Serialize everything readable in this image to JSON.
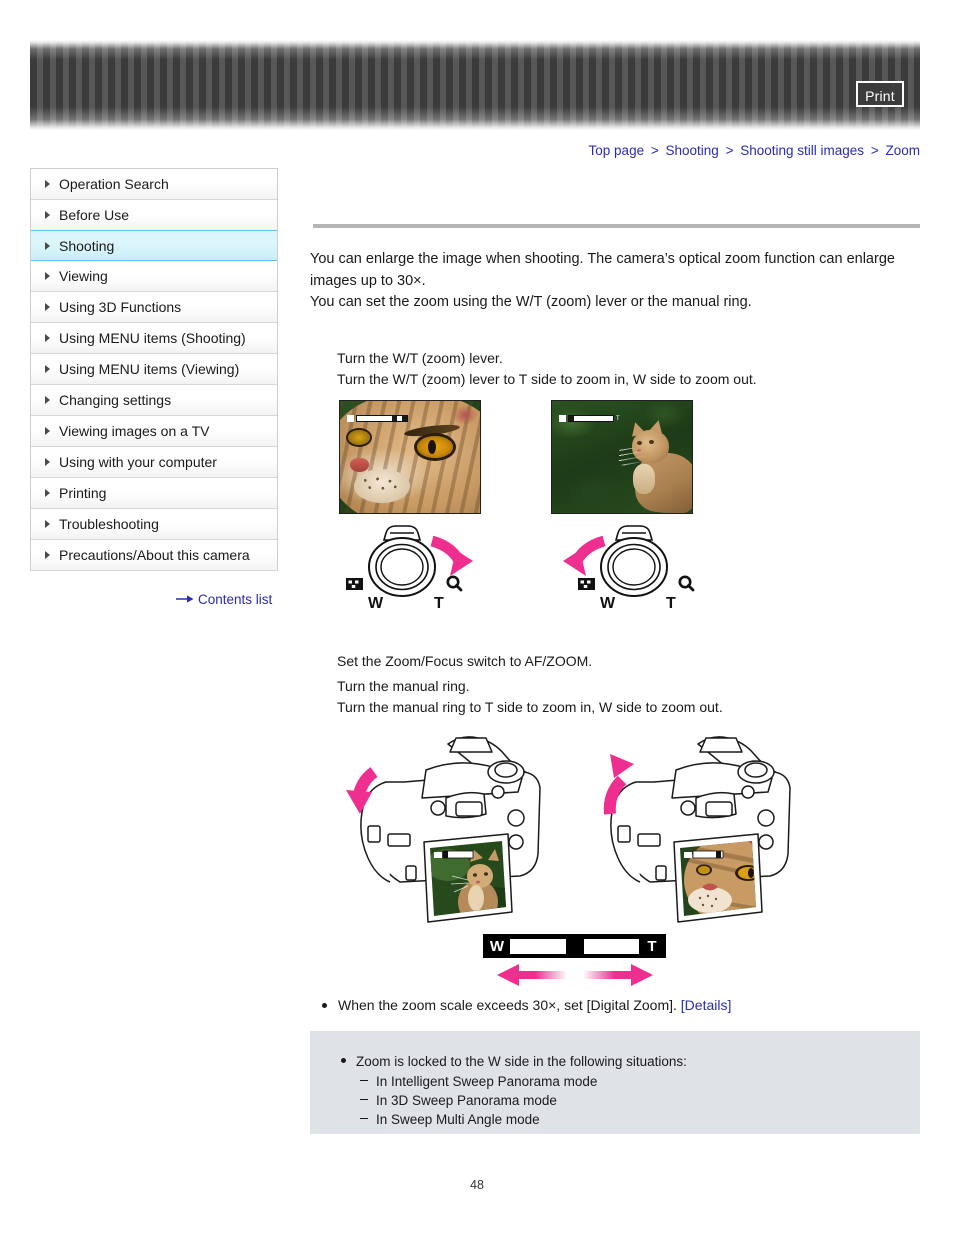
{
  "header": {
    "print_label": "Print"
  },
  "breadcrumb": {
    "items": [
      "Top page",
      "Shooting",
      "Shooting still images",
      "Zoom"
    ],
    "separator": ">"
  },
  "sidebar": {
    "items": [
      {
        "label": "Operation Search",
        "active": false
      },
      {
        "label": "Before Use",
        "active": false
      },
      {
        "label": "Shooting",
        "active": true
      },
      {
        "label": "Viewing",
        "active": false
      },
      {
        "label": "Using 3D Functions",
        "active": false
      },
      {
        "label": "Using MENU items (Shooting)",
        "active": false
      },
      {
        "label": "Using MENU items (Viewing)",
        "active": false
      },
      {
        "label": "Changing settings",
        "active": false
      },
      {
        "label": "Viewing images on a TV",
        "active": false
      },
      {
        "label": "Using with your computer",
        "active": false
      },
      {
        "label": "Printing",
        "active": false
      },
      {
        "label": "Troubleshooting",
        "active": false
      },
      {
        "label": "Precautions/About this camera",
        "active": false
      }
    ],
    "contents_link": "Contents list"
  },
  "main": {
    "intro_line1": "You can enlarge the image when shooting. The camera’s optical zoom function can enlarge",
    "intro_line2": "images up to 30×.",
    "intro_line3": "You can set the zoom using the W/T (zoom) lever or the manual ring.",
    "step1_line1": "Turn the W/T (zoom) lever.",
    "step1_line2": "Turn the W/T (zoom) lever to T side to zoom in, W side to zoom out.",
    "step2_line1": "Set the Zoom/Focus switch to AF/ZOOM.",
    "step3_line1": "Turn the manual ring.",
    "step3_line2": "Turn the manual ring to T side to zoom in, W side to zoom out.",
    "lever": {
      "w_label": "W",
      "t_label": "T"
    },
    "wt_bar": {
      "w_label": "W",
      "t_label": "T"
    },
    "note_text": "When the zoom scale exceeds 30×, set [Digital Zoom].",
    "note_link": "[Details]"
  },
  "note_box": {
    "heading": "Zoom is locked to the W side in the following situations:",
    "items": [
      "In Intelligent Sweep Panorama mode",
      "In 3D Sweep Panorama mode",
      "In Sweep Multi Angle mode"
    ]
  },
  "footer": {
    "page_number": "48"
  },
  "colors": {
    "link": "#2b2bb5",
    "accent_pink": "#ef2f8f",
    "active_nav": "#d9f4fa",
    "note_box_bg": "#dfe3e8"
  }
}
